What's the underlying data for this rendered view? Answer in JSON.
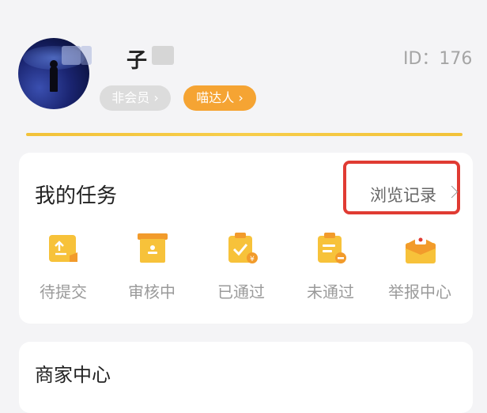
{
  "profile": {
    "name_visible": "子",
    "id_text": "ID：176",
    "member_badge": "非会员",
    "talent_badge": "喵达人"
  },
  "tasks": {
    "title": "我的任务",
    "history_link": "浏览记录",
    "items": [
      {
        "label": "待提交",
        "icon": "upload-doc-icon"
      },
      {
        "label": "审核中",
        "icon": "review-box-icon"
      },
      {
        "label": "已通过",
        "icon": "approved-clipboard-icon"
      },
      {
        "label": "未通过",
        "icon": "rejected-clipboard-icon"
      },
      {
        "label": "举报中心",
        "icon": "report-envelope-icon"
      }
    ]
  },
  "merchant": {
    "title": "商家中心"
  },
  "colors": {
    "icon_yellow": "#f7c23a",
    "icon_orange": "#f29b2b",
    "highlight_red": "#e03b33",
    "gold_line": "#f2c239"
  }
}
